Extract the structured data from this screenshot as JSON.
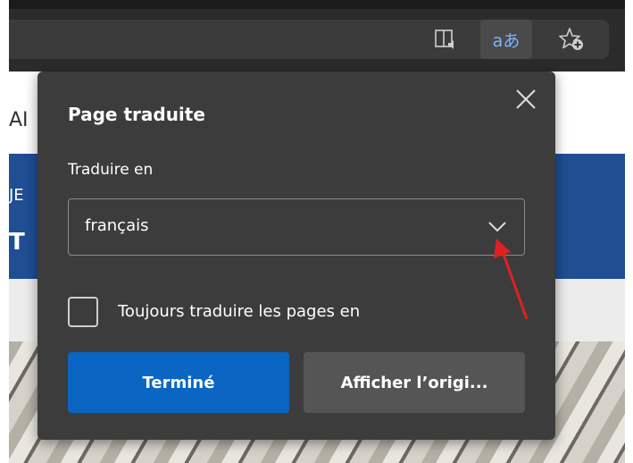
{
  "toolbar": {
    "translate_icon_text": "aあ",
    "reader_icon": "immersive-reader-icon",
    "favorites_icon": "add-favorite-icon"
  },
  "page_background": {
    "fragment_1": "AI",
    "fragment_2": "JE",
    "fragment_3": "T"
  },
  "dialog": {
    "title": "Page traduite",
    "translate_to_label": "Traduire en",
    "language_selected": "français",
    "always_translate_label": "Toujours traduire les pages en",
    "always_translate_checked": false,
    "done_button": "Terminé",
    "show_original_button": "Afficher l’origi..."
  },
  "colors": {
    "dialog_bg": "#3c3c3c",
    "primary_button": "#0a66c2",
    "secondary_button": "#555555",
    "annotation_arrow": "#e02020"
  }
}
